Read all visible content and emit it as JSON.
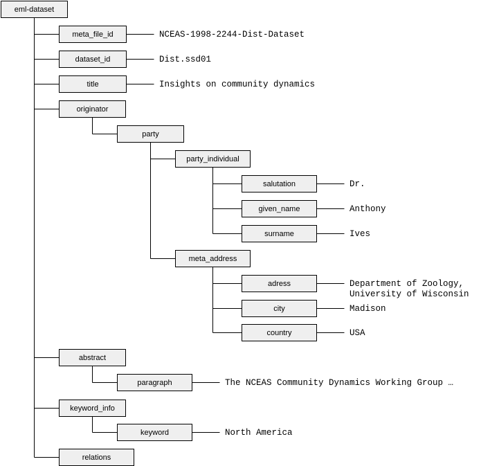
{
  "diagram": {
    "root": "eml-dataset",
    "nodes": {
      "meta_file_id": {
        "label": "meta_file_id",
        "value": [
          "NCEAS-1998-2244-Dist-Dataset"
        ]
      },
      "dataset_id": {
        "label": "dataset_id",
        "value": [
          "Dist.ssd01"
        ]
      },
      "title": {
        "label": "title",
        "value": [
          "Insights on community dynamics"
        ]
      },
      "originator": {
        "label": "originator"
      },
      "party": {
        "label": "party"
      },
      "party_individual": {
        "label": "party_individual"
      },
      "salutation": {
        "label": "salutation",
        "value": [
          "Dr."
        ]
      },
      "given_name": {
        "label": "given_name",
        "value": [
          "Anthony"
        ]
      },
      "surname": {
        "label": "surname",
        "value": [
          "Ives"
        ]
      },
      "meta_address": {
        "label": "meta_address"
      },
      "adress": {
        "label": "adress",
        "value": [
          "Department of Zoology,",
          "University of Wisconsin"
        ]
      },
      "city": {
        "label": "city",
        "value": [
          "Madison"
        ]
      },
      "country": {
        "label": "country",
        "value": [
          "USA"
        ]
      },
      "abstract": {
        "label": "abstract"
      },
      "paragraph": {
        "label": "paragraph",
        "value": [
          "The NCEAS Community Dynamics Working Group …"
        ]
      },
      "keyword_info": {
        "label": "keyword_info"
      },
      "keyword": {
        "label": "keyword",
        "value": [
          "North America"
        ]
      },
      "relations": {
        "label": "relations"
      }
    }
  }
}
